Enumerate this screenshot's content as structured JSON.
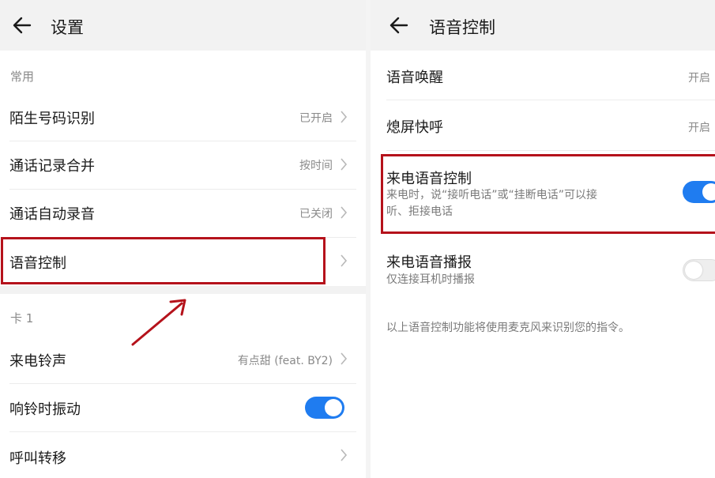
{
  "left_screen": {
    "header": {
      "title": "设置",
      "back_icon": "arrow-left-icon"
    },
    "section_common": "常用",
    "items": [
      {
        "label": "陌生号码识别",
        "value": "已开启"
      },
      {
        "label": "通话记录合并",
        "value": "按时间"
      },
      {
        "label": "通话自动录音",
        "value": "已关闭"
      },
      {
        "label": "语音控制",
        "value": ""
      }
    ],
    "section_card": "卡 1",
    "card_items": [
      {
        "label": "来电铃声",
        "value": "有点甜 (feat. BY2)"
      },
      {
        "label": "响铃时振动",
        "toggle": true
      },
      {
        "label": "呼叫转移",
        "value": ""
      }
    ]
  },
  "right_screen": {
    "header": {
      "title": "语音控制",
      "back_icon": "arrow-left-icon"
    },
    "items": [
      {
        "label": "语音唤醒",
        "value": "开启"
      },
      {
        "label": "熄屏快呼",
        "value": "开启"
      },
      {
        "label": "来电语音控制",
        "desc_line1": "来电时，说“接听电话”或“挂断电话”可以接",
        "desc_line2": "听、拒接电话",
        "toggle": true
      },
      {
        "label": "来电语音播报",
        "desc_line1": "仅连接耳机时播报",
        "toggle": false
      }
    ],
    "footer_note": "以上语音控制功能将使用麦克风来识别您的指令。"
  },
  "colors": {
    "accent": "#1f7cf0",
    "highlight": "#b5121b",
    "header_bg": "#f2f2f2"
  }
}
